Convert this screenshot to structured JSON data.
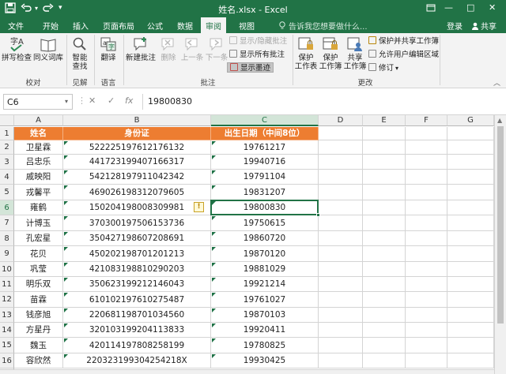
{
  "window": {
    "title": "姓名.xlsx - Excel",
    "qat": {
      "save_icon": "save-icon",
      "undo_icon": "undo-icon",
      "redo_icon": "redo-icon",
      "customize_icon": "customize-icon"
    },
    "controls": {
      "restore_icon": "restore-icon",
      "minimize": "—",
      "maximize": "□",
      "close": "✕"
    }
  },
  "tabs": [
    "文件",
    "开始",
    "插入",
    "页面布局",
    "公式",
    "数据",
    "审阅",
    "视图"
  ],
  "active_tab": "审阅",
  "tell_me": "告诉我您想要做什么...",
  "login": "登录",
  "share": "共享",
  "ribbon": {
    "groups": [
      {
        "label": "校对",
        "buttons": [
          "拼写检查",
          "同义词库"
        ]
      },
      {
        "label": "见解",
        "buttons": [
          "智能\n查找"
        ]
      },
      {
        "label": "语言",
        "buttons": [
          "翻译"
        ]
      },
      {
        "label": "批注",
        "buttons": [
          "新建批注",
          "删除",
          "上一条",
          "下一条"
        ],
        "small": [
          "显示/隐藏批注",
          "显示所有批注",
          "显示墨迹"
        ]
      },
      {
        "label": "更改",
        "buttons": [
          "保护\n工作表",
          "保护\n工作簿",
          "共享\n工作簿"
        ],
        "small": [
          "保护并共享工作簿",
          "允许用户编辑区域",
          "修订"
        ]
      }
    ]
  },
  "formula_bar": {
    "name_box": "C6",
    "cancel": "✕",
    "enter": "✓",
    "fx": "fx",
    "formula": "19800830"
  },
  "sheet": {
    "columns": [
      "A",
      "B",
      "C",
      "D",
      "E",
      "F",
      "G"
    ],
    "selected_column": "C",
    "row_numbers": [
      "1",
      "2",
      "3",
      "4",
      "5",
      "6",
      "7",
      "8",
      "9",
      "10",
      "11",
      "12",
      "13",
      "14",
      "15",
      "16",
      "17"
    ],
    "selected_row": "6",
    "header": [
      "姓名",
      "身份证",
      "出生日期（中间8位）"
    ],
    "rows": [
      [
        "卫星霖",
        "522225197612176132",
        "19761217"
      ],
      [
        "吕忠乐",
        "441723199407166317",
        "19940716"
      ],
      [
        "戚映阳",
        "542128197911042342",
        "19791104"
      ],
      [
        "戎馨平",
        "469026198312079605",
        "19831207"
      ],
      [
        "雍鹤",
        "150204198008309981",
        "19800830"
      ],
      [
        "计博玉",
        "370300197506153736",
        "19750615"
      ],
      [
        "孔宏星",
        "350427198607208691",
        "19860720"
      ],
      [
        "花贝",
        "450202198701201213",
        "19870120"
      ],
      [
        "巩莹",
        "421083198810290203",
        "19881029"
      ],
      [
        "明乐双",
        "350623199212146043",
        "19921214"
      ],
      [
        "苗霖",
        "610102197610275487",
        "19761027"
      ],
      [
        "钱彦旭",
        "220681198701034560",
        "19870103"
      ],
      [
        "方星丹",
        "320103199204113833",
        "19920411"
      ],
      [
        "魏玉",
        "420114197808258199",
        "19780825"
      ],
      [
        "容欣然",
        "220323199304254218X",
        "19930425"
      ]
    ],
    "warning_icon": "!",
    "colors": {
      "header_fill": "#ed7d31",
      "accent": "#217346"
    }
  }
}
